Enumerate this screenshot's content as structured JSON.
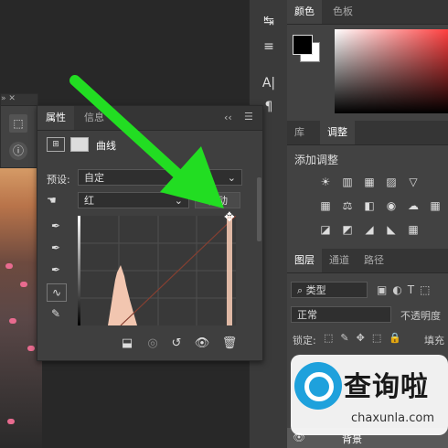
{
  "mini_panel": {
    "buttons": [
      {
        "icon": "cube-icon"
      },
      {
        "icon": "info-icon"
      }
    ],
    "header_glyphs": "»  ✕"
  },
  "toolstrip": {
    "tools": [
      {
        "icon": "history-icon",
        "glyph": "↹"
      },
      {
        "icon": "adjust-sliders-icon",
        "glyph": "≡"
      },
      {
        "icon": "character-icon",
        "glyph": "A|"
      },
      {
        "icon": "paragraph-icon",
        "glyph": "¶"
      }
    ]
  },
  "color_panel": {
    "tabs": [
      "颜色",
      "色板"
    ],
    "fg_color": "#000000",
    "bg_color": "#ffffff"
  },
  "adjustments_panel": {
    "tabs": [
      "库",
      "调整"
    ],
    "add_label": "添加调整",
    "row1": [
      "☀",
      "▥",
      "▦",
      "▨",
      "▽"
    ],
    "row2": [
      "▦",
      "⚖",
      "◧",
      "◉",
      "☁",
      "▦"
    ],
    "row3": [
      "◪",
      "◩",
      "◢",
      "◣",
      "▦"
    ]
  },
  "layers_panel": {
    "tabs": [
      "图层",
      "通道",
      "路径"
    ],
    "filter_label": "类型",
    "blend_mode": "正常",
    "opacity_label": "不透明度",
    "lock_label": "锁定:",
    "fill_label": "填充",
    "layer_name": "背景"
  },
  "properties_panel": {
    "tabs": [
      "属性",
      "信息"
    ],
    "title": "曲线",
    "preset_label": "预设:",
    "preset_value": "自定",
    "channel_value": "红",
    "auto_button": "自动",
    "curve_accent": "#8b3a2a",
    "histogram_color": "#f2c6b0"
  },
  "watermark": {
    "title": "查询啦",
    "sub": "chaxunla.com"
  },
  "annotation": {
    "arrow_color": "#22dd22"
  }
}
